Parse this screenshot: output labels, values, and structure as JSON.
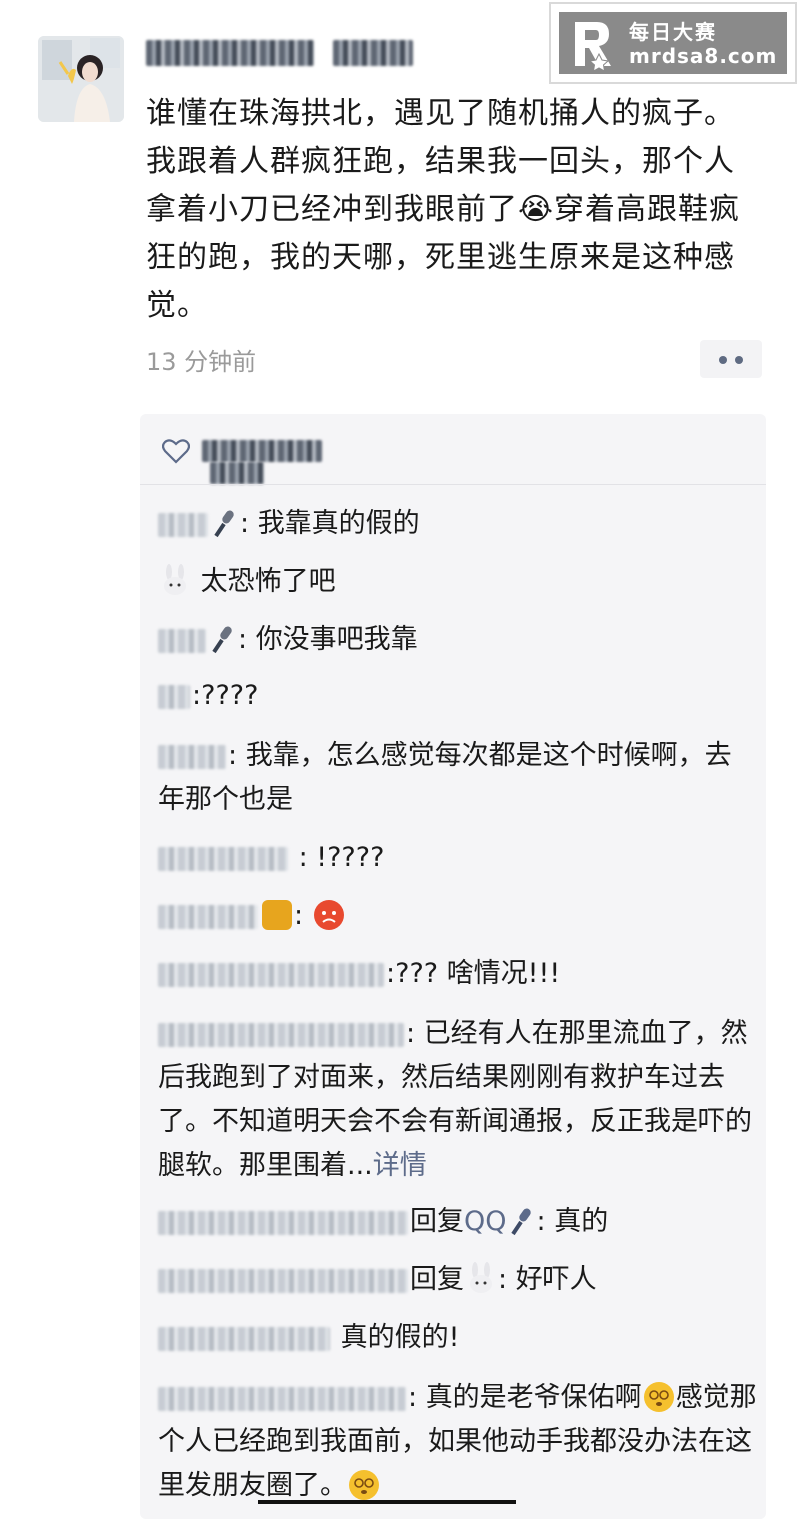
{
  "watermark": {
    "title": "每日大赛",
    "url": "mrdsa8.com"
  },
  "post": {
    "text": "谁懂在珠海拱北，遇见了随机捅人的疯子。我跟着人群疯狂跑，结果我一回头，那个人拿着小刀已经冲到我眼前了😭穿着高跟鞋疯狂的跑，我的天哪，死里逃生原来是这种感觉。",
    "time": "13 分钟前"
  },
  "comments": [
    {
      "sep": ": ",
      "text": "我靠真的假的"
    },
    {
      "sep": " ",
      "text": "太恐怖了吧"
    },
    {
      "sep": ": ",
      "text": "你没事吧我靠"
    },
    {
      "sep": ":",
      "text": "????"
    },
    {
      "sep": ": ",
      "text": "我靠，怎么感觉每次都是这个时候啊，去年那个也是"
    },
    {
      "sep": " : ",
      "text": "!????"
    },
    {
      "sep": ":",
      "text": ""
    },
    {
      "sep": ":",
      "text": "??? 啥情况!!!"
    },
    {
      "sep": ": ",
      "text": "已经有人在那里流血了，然后我跑到了对面来，然后结果刚刚有救护车过去了。不知道明天会不会有新闻通报，反正我是吓的腿软。那里围着...",
      "more": "详情"
    },
    {
      "reply_label": "回复",
      "reply_to": "QQ",
      "sep": ": ",
      "text": "真的"
    },
    {
      "reply_label": "回复",
      "sep": ": ",
      "text": "好吓人"
    },
    {
      "sep": " ",
      "text": "真的假的!"
    },
    {
      "sep": ": ",
      "text": "真的是老爷保佑啊",
      "text2": "感觉那个人已经跑到我面前，如果他动手我都没办法在这里发朋友圈了。"
    }
  ],
  "icons": {
    "like": "heart-outline-icon",
    "microphone": "microphone-icon",
    "rabbit": "rabbit-icon",
    "crying_emoji": "crying-face-icon",
    "angry_emoji": "angry-face-icon",
    "dizzy_emoji": "dizzy-face-icon",
    "honey_emoji": "honey-pot-icon"
  },
  "colors": {
    "link": "#5d6b8a",
    "comment_bg": "#f5f5f7",
    "time": "#9a9a9a"
  }
}
